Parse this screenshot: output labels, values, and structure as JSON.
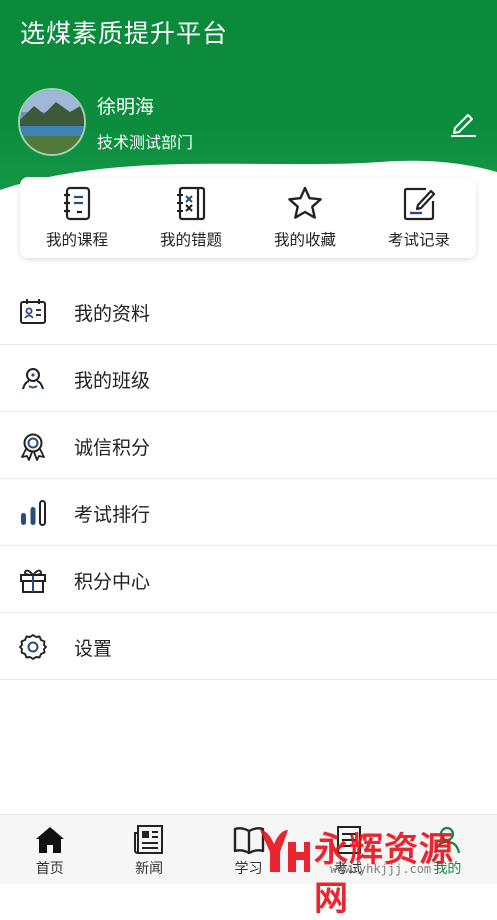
{
  "app": {
    "title": "选煤素质提升平台"
  },
  "profile": {
    "name": "徐明海",
    "department": "技术测试部门"
  },
  "quick_actions": [
    {
      "label": "我的课程",
      "icon": "course-icon"
    },
    {
      "label": "我的错题",
      "icon": "wrong-questions-icon"
    },
    {
      "label": "我的收藏",
      "icon": "star-icon"
    },
    {
      "label": "考试记录",
      "icon": "exam-record-icon"
    }
  ],
  "menu": [
    {
      "label": "我的资料",
      "icon": "profile-card-icon"
    },
    {
      "label": "我的班级",
      "icon": "class-icon"
    },
    {
      "label": "诚信积分",
      "icon": "badge-icon"
    },
    {
      "label": "考试排行",
      "icon": "ranking-bars-icon"
    },
    {
      "label": "积分中心",
      "icon": "gift-icon"
    },
    {
      "label": "设置",
      "icon": "gear-icon"
    }
  ],
  "tabbar": {
    "tabs": [
      {
        "label": "首页",
        "icon": "home-icon"
      },
      {
        "label": "新闻",
        "icon": "news-icon"
      },
      {
        "label": "学习",
        "icon": "book-icon"
      },
      {
        "label": "考试",
        "icon": "exam-icon"
      },
      {
        "label": "我的",
        "icon": "user-icon"
      }
    ],
    "active_index": 4
  },
  "watermark": {
    "text": "永辉资源网",
    "url": "www.yhkjjj.com"
  },
  "colors": {
    "brand_green": "#0c8c3d",
    "icon_blue": "#2b4c7e",
    "watermark_red": "#e8141f"
  }
}
